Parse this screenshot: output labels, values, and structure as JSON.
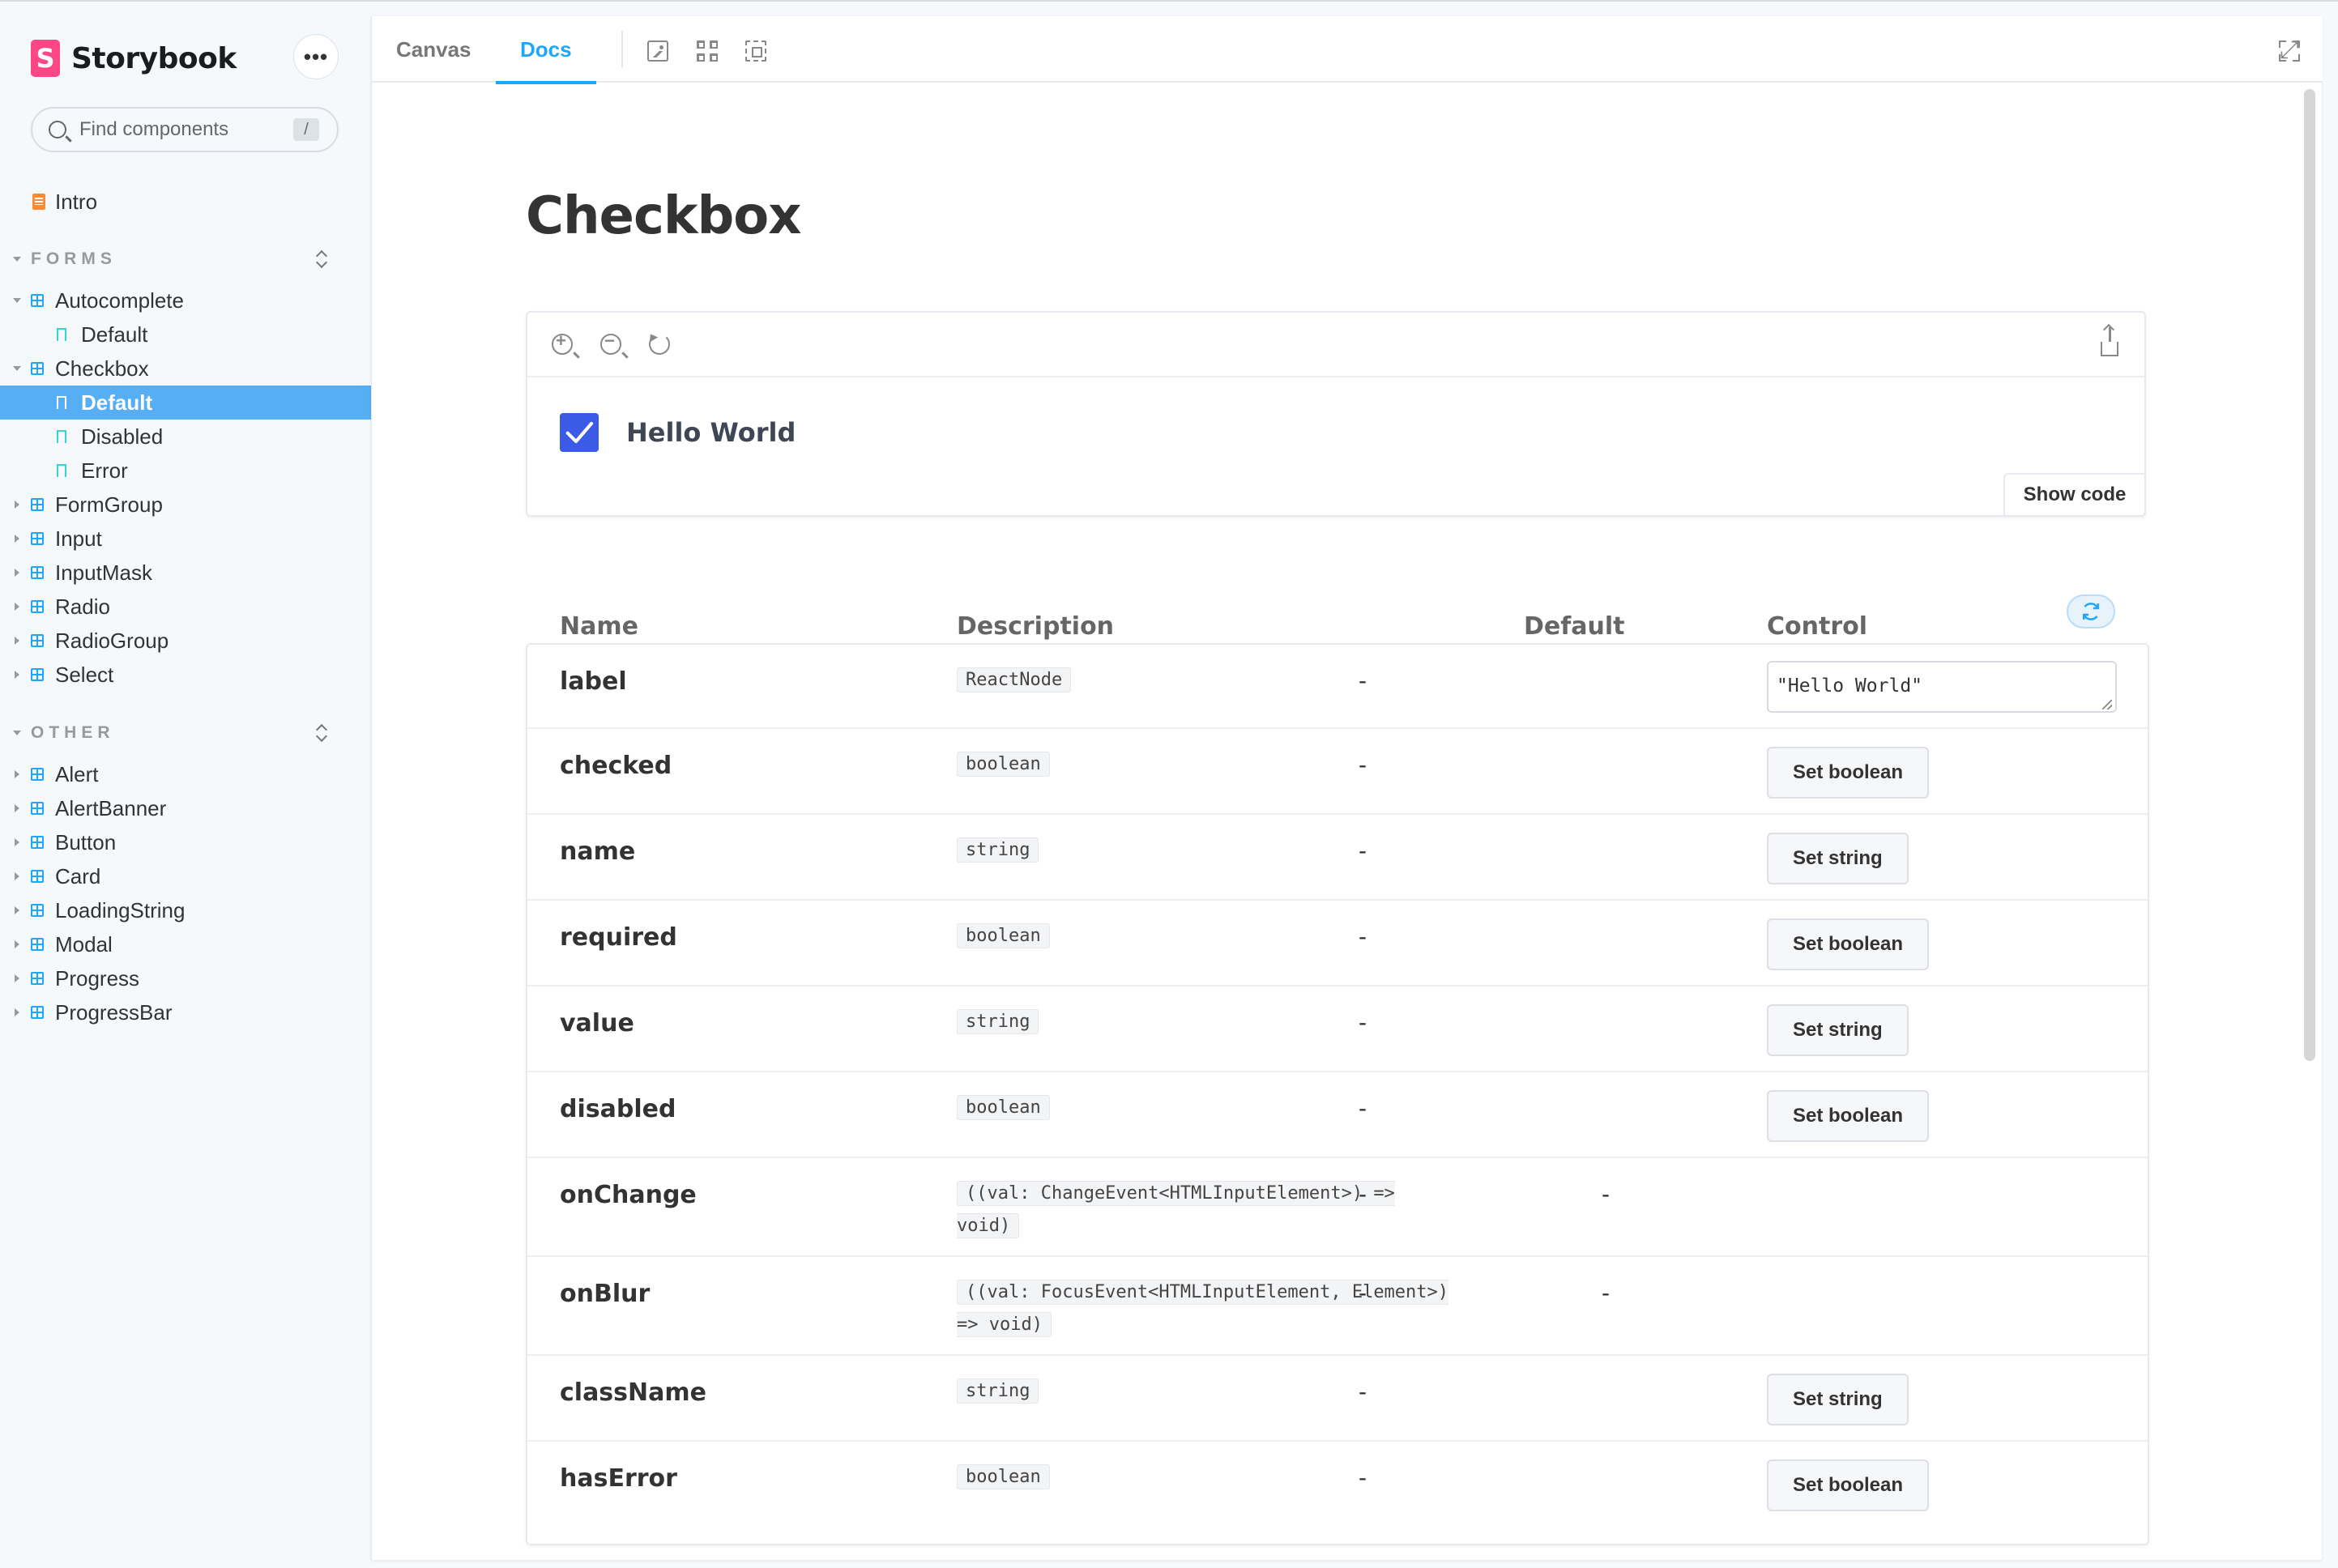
{
  "app": {
    "name": "Storybook",
    "logo_letter": "S",
    "more_label": "•••"
  },
  "search": {
    "placeholder": "Find components",
    "shortcut": "/"
  },
  "sidebar": {
    "intro": "Intro",
    "groups": [
      {
        "title": "FORMS",
        "items": [
          {
            "label": "Autocomplete",
            "expanded": true,
            "stories": [
              "Default"
            ]
          },
          {
            "label": "Checkbox",
            "expanded": true,
            "stories": [
              "Default",
              "Disabled",
              "Error"
            ],
            "selected_story": "Default"
          },
          {
            "label": "FormGroup"
          },
          {
            "label": "Input"
          },
          {
            "label": "InputMask"
          },
          {
            "label": "Radio"
          },
          {
            "label": "RadioGroup"
          },
          {
            "label": "Select"
          }
        ]
      },
      {
        "title": "OTHER",
        "items": [
          {
            "label": "Alert"
          },
          {
            "label": "AlertBanner"
          },
          {
            "label": "Button"
          },
          {
            "label": "Card"
          },
          {
            "label": "LoadingString"
          },
          {
            "label": "Modal"
          },
          {
            "label": "Progress"
          },
          {
            "label": "ProgressBar"
          }
        ]
      }
    ]
  },
  "toolbar": {
    "tabs": [
      "Canvas",
      "Docs"
    ],
    "active_tab": "Docs"
  },
  "doc": {
    "title": "Checkbox",
    "preview": {
      "checkbox_label": "Hello World",
      "checked": true,
      "show_code": "Show code"
    }
  },
  "args_table": {
    "headers": {
      "name": "Name",
      "description": "Description",
      "default": "Default",
      "control": "Control"
    },
    "rows": [
      {
        "name": "label",
        "type": "ReactNode",
        "default": "-",
        "control": {
          "kind": "textarea",
          "value": "\"Hello World\""
        }
      },
      {
        "name": "checked",
        "type": "boolean",
        "default": "-",
        "control": {
          "kind": "button",
          "label": "Set boolean"
        }
      },
      {
        "name": "name",
        "type": "string",
        "default": "-",
        "control": {
          "kind": "button",
          "label": "Set string"
        }
      },
      {
        "name": "required",
        "type": "boolean",
        "default": "-",
        "control": {
          "kind": "button",
          "label": "Set boolean"
        }
      },
      {
        "name": "value",
        "type": "string",
        "default": "-",
        "control": {
          "kind": "button",
          "label": "Set string"
        }
      },
      {
        "name": "disabled",
        "type": "boolean",
        "default": "-",
        "control": {
          "kind": "button",
          "label": "Set boolean"
        }
      },
      {
        "name": "onChange",
        "type": "((val: ChangeEvent<HTMLInputElement>) => void)",
        "default": "-",
        "control": {
          "kind": "none",
          "label": "-"
        }
      },
      {
        "name": "onBlur",
        "type": "((val: FocusEvent<HTMLInputElement, Element>) => void)",
        "default": "-",
        "control": {
          "kind": "none",
          "label": "-"
        }
      },
      {
        "name": "className",
        "type": "string",
        "default": "-",
        "control": {
          "kind": "button",
          "label": "Set string"
        }
      },
      {
        "name": "hasError",
        "type": "boolean",
        "default": "-",
        "control": {
          "kind": "button",
          "label": "Set boolean"
        }
      }
    ]
  },
  "colors": {
    "accent": "#1ea7fd",
    "selected_bg": "#56aef5",
    "brand": "#ff4785",
    "checkbox": "#3b5be6"
  }
}
